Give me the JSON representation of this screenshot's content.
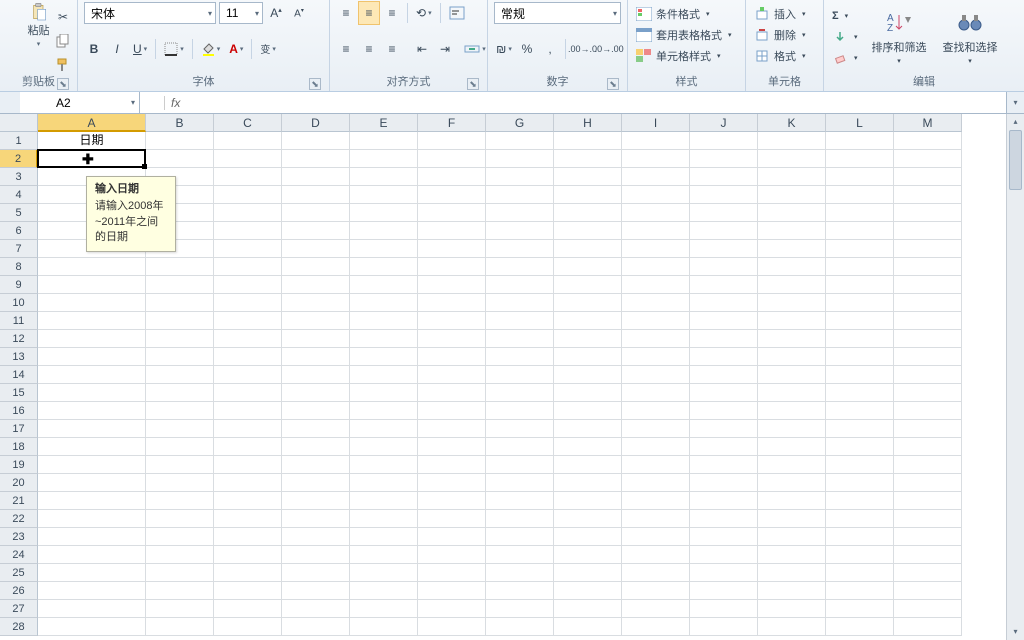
{
  "ribbon": {
    "clipboard": {
      "paste": "粘贴",
      "label": "剪贴板"
    },
    "font": {
      "name": "宋体",
      "size": "11",
      "label": "字体",
      "bold": "B",
      "italic": "I",
      "underline": "U",
      "phonetic": "变"
    },
    "alignment": {
      "label": "对齐方式"
    },
    "number": {
      "format": "常规",
      "label": "数字",
      "percent": "%",
      "comma": ",",
      "currency_sym": "₪"
    },
    "styles": {
      "cond": "条件格式",
      "table": "套用表格格式",
      "cell": "单元格样式",
      "label": "样式"
    },
    "cells": {
      "insert": "插入",
      "delete": "删除",
      "format": "格式",
      "label": "单元格"
    },
    "editing": {
      "sort": "排序和筛选",
      "find": "查找和选择",
      "label": "编辑",
      "sigma": "Σ"
    }
  },
  "namebox": {
    "ref": "A2",
    "fx": "fx"
  },
  "columns": [
    "A",
    "B",
    "C",
    "D",
    "E",
    "F",
    "G",
    "H",
    "I",
    "J",
    "K",
    "L",
    "M"
  ],
  "rows_count": 28,
  "selected_col": "A",
  "selected_row": 2,
  "cells": {
    "A1": "日期"
  },
  "tooltip": {
    "title": "输入日期",
    "body": "请输入2008年~2011年之间的日期"
  }
}
